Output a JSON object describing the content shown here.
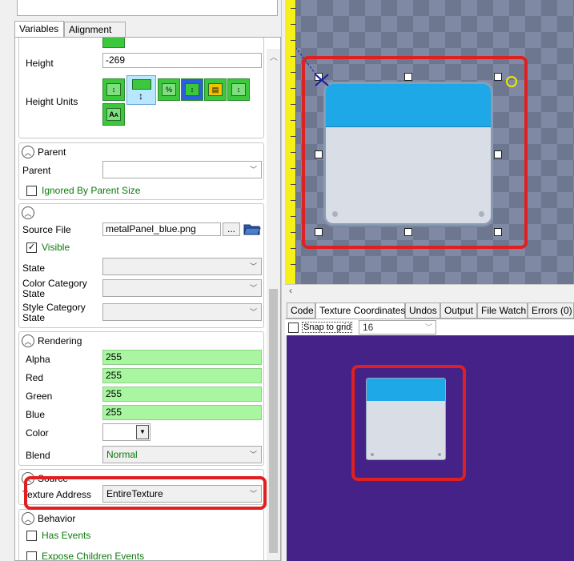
{
  "tabs": [
    "Variables",
    "Alignment"
  ],
  "height": {
    "label": "Height",
    "value": "-269"
  },
  "height_units": {
    "label": "Height Units",
    "selected_index": 1
  },
  "parent_section": {
    "header": "Parent",
    "parent_label": "Parent",
    "parent_value": "",
    "ignored_label": "Ignored By Parent Size",
    "ignored_checked": false
  },
  "source_file_section": {
    "source_file_label": "Source File",
    "source_file_value": "metalPanel_blue.png",
    "browse_label": "...",
    "visible_label": "Visible",
    "visible_checked": true,
    "state_label": "State",
    "color_category_label": "Color Category State",
    "style_category_label": "Style Category State"
  },
  "rendering": {
    "header": "Rendering",
    "alpha_label": "Alpha",
    "alpha_value": "255",
    "red_label": "Red",
    "red_value": "255",
    "green_label": "Green",
    "green_value": "255",
    "blue_label": "Blue",
    "blue_value": "255",
    "color_label": "Color",
    "color_value": "#ffffff",
    "blend_label": "Blend",
    "blend_value": "Normal"
  },
  "source": {
    "header": "Source",
    "texture_address_label": "Texture Address",
    "texture_address_value": "EntireTexture"
  },
  "behavior": {
    "header": "Behavior",
    "has_events_label": "Has Events",
    "has_events_checked": false,
    "expose_children_label": "Expose Children Events",
    "expose_children_checked": false
  },
  "bottom_tabs": [
    "Code",
    "Texture Coordinates",
    "Undos",
    "Output",
    "File Watch",
    "Errors (0)"
  ],
  "bottom_active_tab": "Texture Coordinates",
  "snap": {
    "label": "Snap to grid",
    "checked": false,
    "grid_value": "16"
  },
  "colors": {
    "highlight_red": "#e02020",
    "value_green": "#a8f7a0",
    "panel_blue": "#1ea8e8",
    "texture_bg": "#452287",
    "ruler_yellow": "#f7ef1a"
  }
}
